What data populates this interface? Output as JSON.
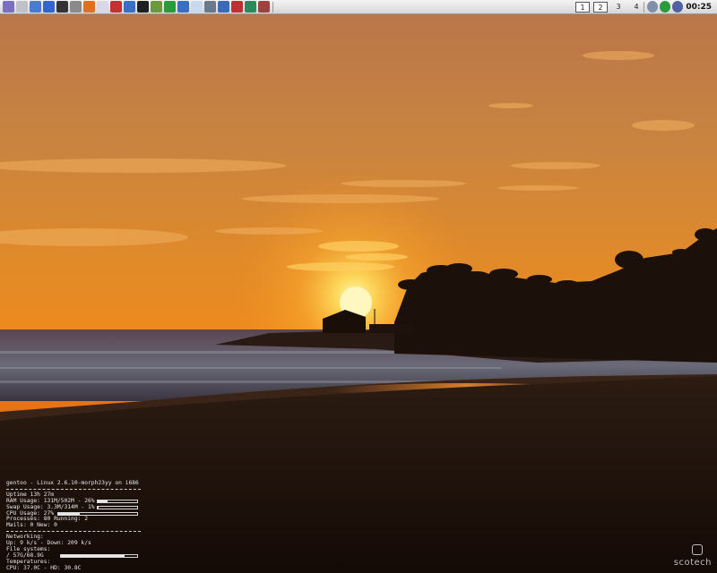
{
  "panel": {
    "launchers": [
      {
        "icon": "gentoo-menu-icon",
        "color": "#7a6fc2"
      },
      {
        "icon": "clock-widget-icon",
        "color": "#c0c0c8"
      },
      {
        "icon": "home-folder-icon",
        "color": "#4a7bd0"
      },
      {
        "icon": "disk-icon",
        "color": "#3366cc"
      },
      {
        "icon": "terminal-icon",
        "color": "#333333"
      },
      {
        "icon": "tools-icon",
        "color": "#8a8a8a"
      },
      {
        "icon": "star-bookmarks-icon",
        "color": "#e07020"
      },
      {
        "icon": "eraser-icon",
        "color": "#d8d8e8"
      },
      {
        "icon": "mail-icon",
        "color": "#c83030"
      },
      {
        "icon": "display-settings-icon",
        "color": "#3a6fc8"
      },
      {
        "icon": "screen-icon",
        "color": "#202020"
      },
      {
        "icon": "shield-icon",
        "color": "#6a9a3a"
      },
      {
        "icon": "globe-green-icon",
        "color": "#2a9a3a"
      },
      {
        "icon": "web-browser-icon",
        "color": "#3a70c0"
      },
      {
        "icon": "document-icon",
        "color": "#c8d8ee"
      },
      {
        "icon": "volume-icon",
        "color": "#6a7a8a"
      },
      {
        "icon": "image-viewer-icon",
        "color": "#3a6ab8"
      },
      {
        "icon": "grid-app-icon",
        "color": "#c03030"
      },
      {
        "icon": "refresh-icon",
        "color": "#2a8a5a"
      },
      {
        "icon": "graphics-editor-icon",
        "color": "#a04040"
      }
    ],
    "workspaces": [
      "1",
      "2",
      "3",
      "4"
    ],
    "active_workspaces": [
      0,
      1
    ],
    "tray": [
      {
        "icon": "volume-tray-icon",
        "color": "#8090a8"
      },
      {
        "icon": "network-tray-icon",
        "color": "#2a9a3a"
      },
      {
        "icon": "battery-tray-icon",
        "color": "#5060a0"
      }
    ],
    "clock": "00:25"
  },
  "conky": {
    "header": "gentoo - Linux 2.6.10-morph23yy on i686",
    "uptime": "Uptime 13h 27m",
    "ram": "RAM Usage: 131M/502M - 26%",
    "ram_pct": 26,
    "swap": "Swap Usage: 3.3M/314M - 1%",
    "swap_pct": 1,
    "cpu": "CPU Usage: 27%",
    "cpu_pct": 27,
    "processes": "Processes: 80  Running: 2",
    "mails": "Mails: 0 New: 0",
    "networking": "Networking:",
    "net_rate": " Up: 9 k/s - Down: 209 k/s",
    "filesystems": "File systems:",
    "fs_usage": "  / 57G/68.9G",
    "fs_pct": 83,
    "temperatures": "Temperatures:",
    "temps": "  CPU: 37.0C - HD: 30.8C"
  },
  "logo": {
    "text": "scotech"
  }
}
